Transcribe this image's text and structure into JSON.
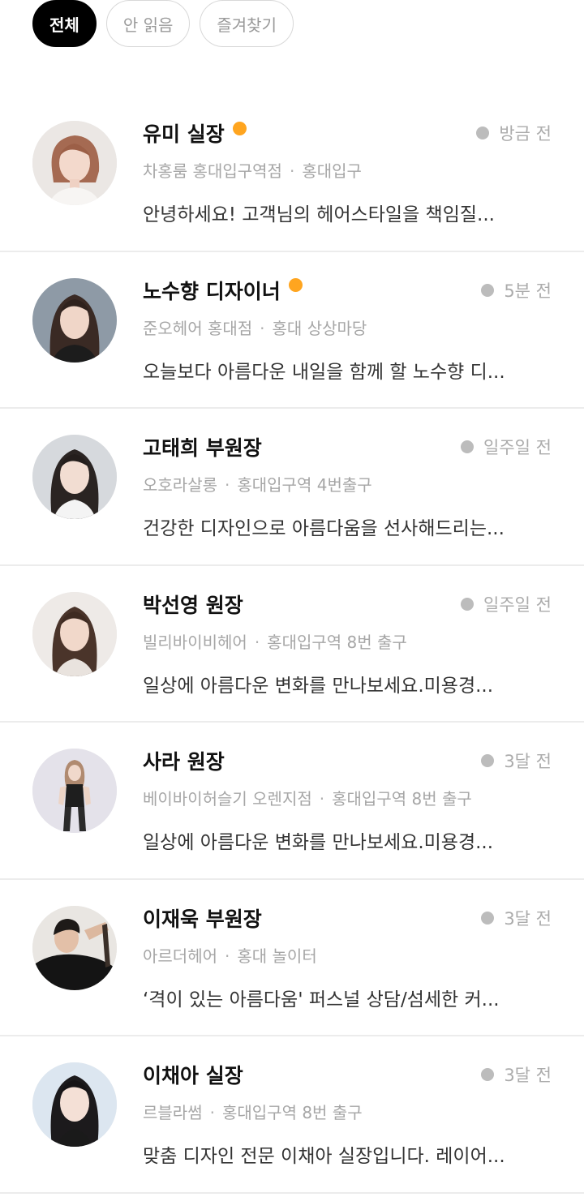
{
  "filters": [
    {
      "label": "전체",
      "active": true
    },
    {
      "label": "안 읽음",
      "active": false
    },
    {
      "label": "즐겨찾기",
      "active": false
    }
  ],
  "colors": {
    "unread_dot": "#ffa51f",
    "time_dot": "#bcbcbc",
    "active_chip_bg": "#000000"
  },
  "chats": [
    {
      "name": "유미 실장",
      "unread": true,
      "time": "방금 전",
      "shop": "차홍룸 홍대입구역점",
      "location": "홍대입구",
      "preview": "안녕하세요! 고객님의 헤어스타일을 책임질...",
      "avatar": "profile-photo"
    },
    {
      "name": "노수향 디자이너",
      "unread": true,
      "time": "5분 전",
      "shop": "준오헤어 홍대점",
      "location": "홍대 상상마당",
      "preview": "오늘보다 아름다운 내일을 함께 할 노수향 디...",
      "avatar": "profile-photo"
    },
    {
      "name": "고태희 부원장",
      "unread": false,
      "time": "일주일 전",
      "shop": "오호라살롱",
      "location": "홍대입구역 4번출구",
      "preview": "건강한 디자인으로 아름다움을 선사해드리는...",
      "avatar": "profile-photo"
    },
    {
      "name": "박선영 원장",
      "unread": false,
      "time": "일주일 전",
      "shop": "빌리바이비헤어",
      "location": "홍대입구역 8번 출구",
      "preview": "일상에 아름다운 변화를 만나보세요.미용경...",
      "avatar": "profile-photo"
    },
    {
      "name": "사라 원장",
      "unread": false,
      "time": "3달 전",
      "shop": "베이바이허슬기 오렌지점",
      "location": "홍대입구역 8번 출구",
      "preview": "일상에 아름다운 변화를 만나보세요.미용경...",
      "avatar": "profile-photo"
    },
    {
      "name": "이재욱 부원장",
      "unread": false,
      "time": "3달 전",
      "shop": "아르더헤어",
      "location": "홍대 놀이터",
      "preview": "‘격이 있는 아름다움' 퍼스널 상담/섬세한 커...",
      "avatar": "profile-photo"
    },
    {
      "name": "이채아 실장",
      "unread": false,
      "time": "3달 전",
      "shop": "르블라썸",
      "location": "홍대입구역 8번 출구",
      "preview": "맞춤 디자인 전문 이채아 실장입니다. 레이어...",
      "avatar": "profile-photo"
    }
  ]
}
